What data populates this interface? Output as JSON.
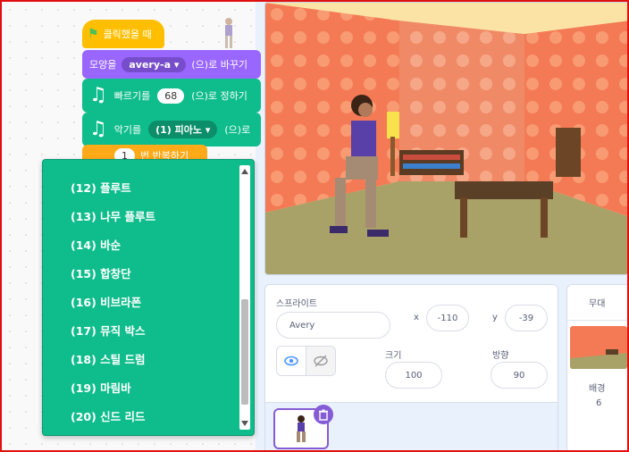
{
  "blocks": {
    "hat_label": "클릭했을 때",
    "looks_prefix": "모양을",
    "looks_value": "avery-a",
    "looks_suffix": "(으)로 바꾸기",
    "tempo_prefix": "빠르기를",
    "tempo_value": "68",
    "tempo_suffix": "(으)로 정하기",
    "instrument_prefix": "악기를",
    "instrument_value": "(1) 피아노",
    "instrument_suffix": "(으)로",
    "repeat_value": "1",
    "repeat_label": "번 반복하기"
  },
  "dropdown": {
    "items": [
      "(12) 플루트",
      "(13) 나무 플루트",
      "(14) 바순",
      "(15) 합창단",
      "(16) 비브라폰",
      "(17) 뮤직 박스",
      "(18) 스틸 드럼",
      "(19) 마림바",
      "(20) 신드 리드"
    ]
  },
  "sprite": {
    "heading": "스프라이트",
    "name": "Avery",
    "x_label": "x",
    "x_value": "-110",
    "y_label": "y",
    "y_value": "-39",
    "size_label": "크기",
    "size_value": "100",
    "direction_label": "방향",
    "direction_value": "90"
  },
  "stage_panel": {
    "heading": "무대",
    "backdrop_label": "배경",
    "backdrop_count": "6"
  },
  "icons": [
    "flag-icon",
    "music-note-icon",
    "eye-icon",
    "eye-hidden-icon",
    "trash-icon",
    "scroll-up-arrow",
    "scroll-down-arrow"
  ],
  "colors": {
    "events": "#ffbf00",
    "looks": "#9966ff",
    "music": "#0fbd8c",
    "control": "#ffab19",
    "accent": "#855cd6",
    "frame": "#e01010"
  }
}
